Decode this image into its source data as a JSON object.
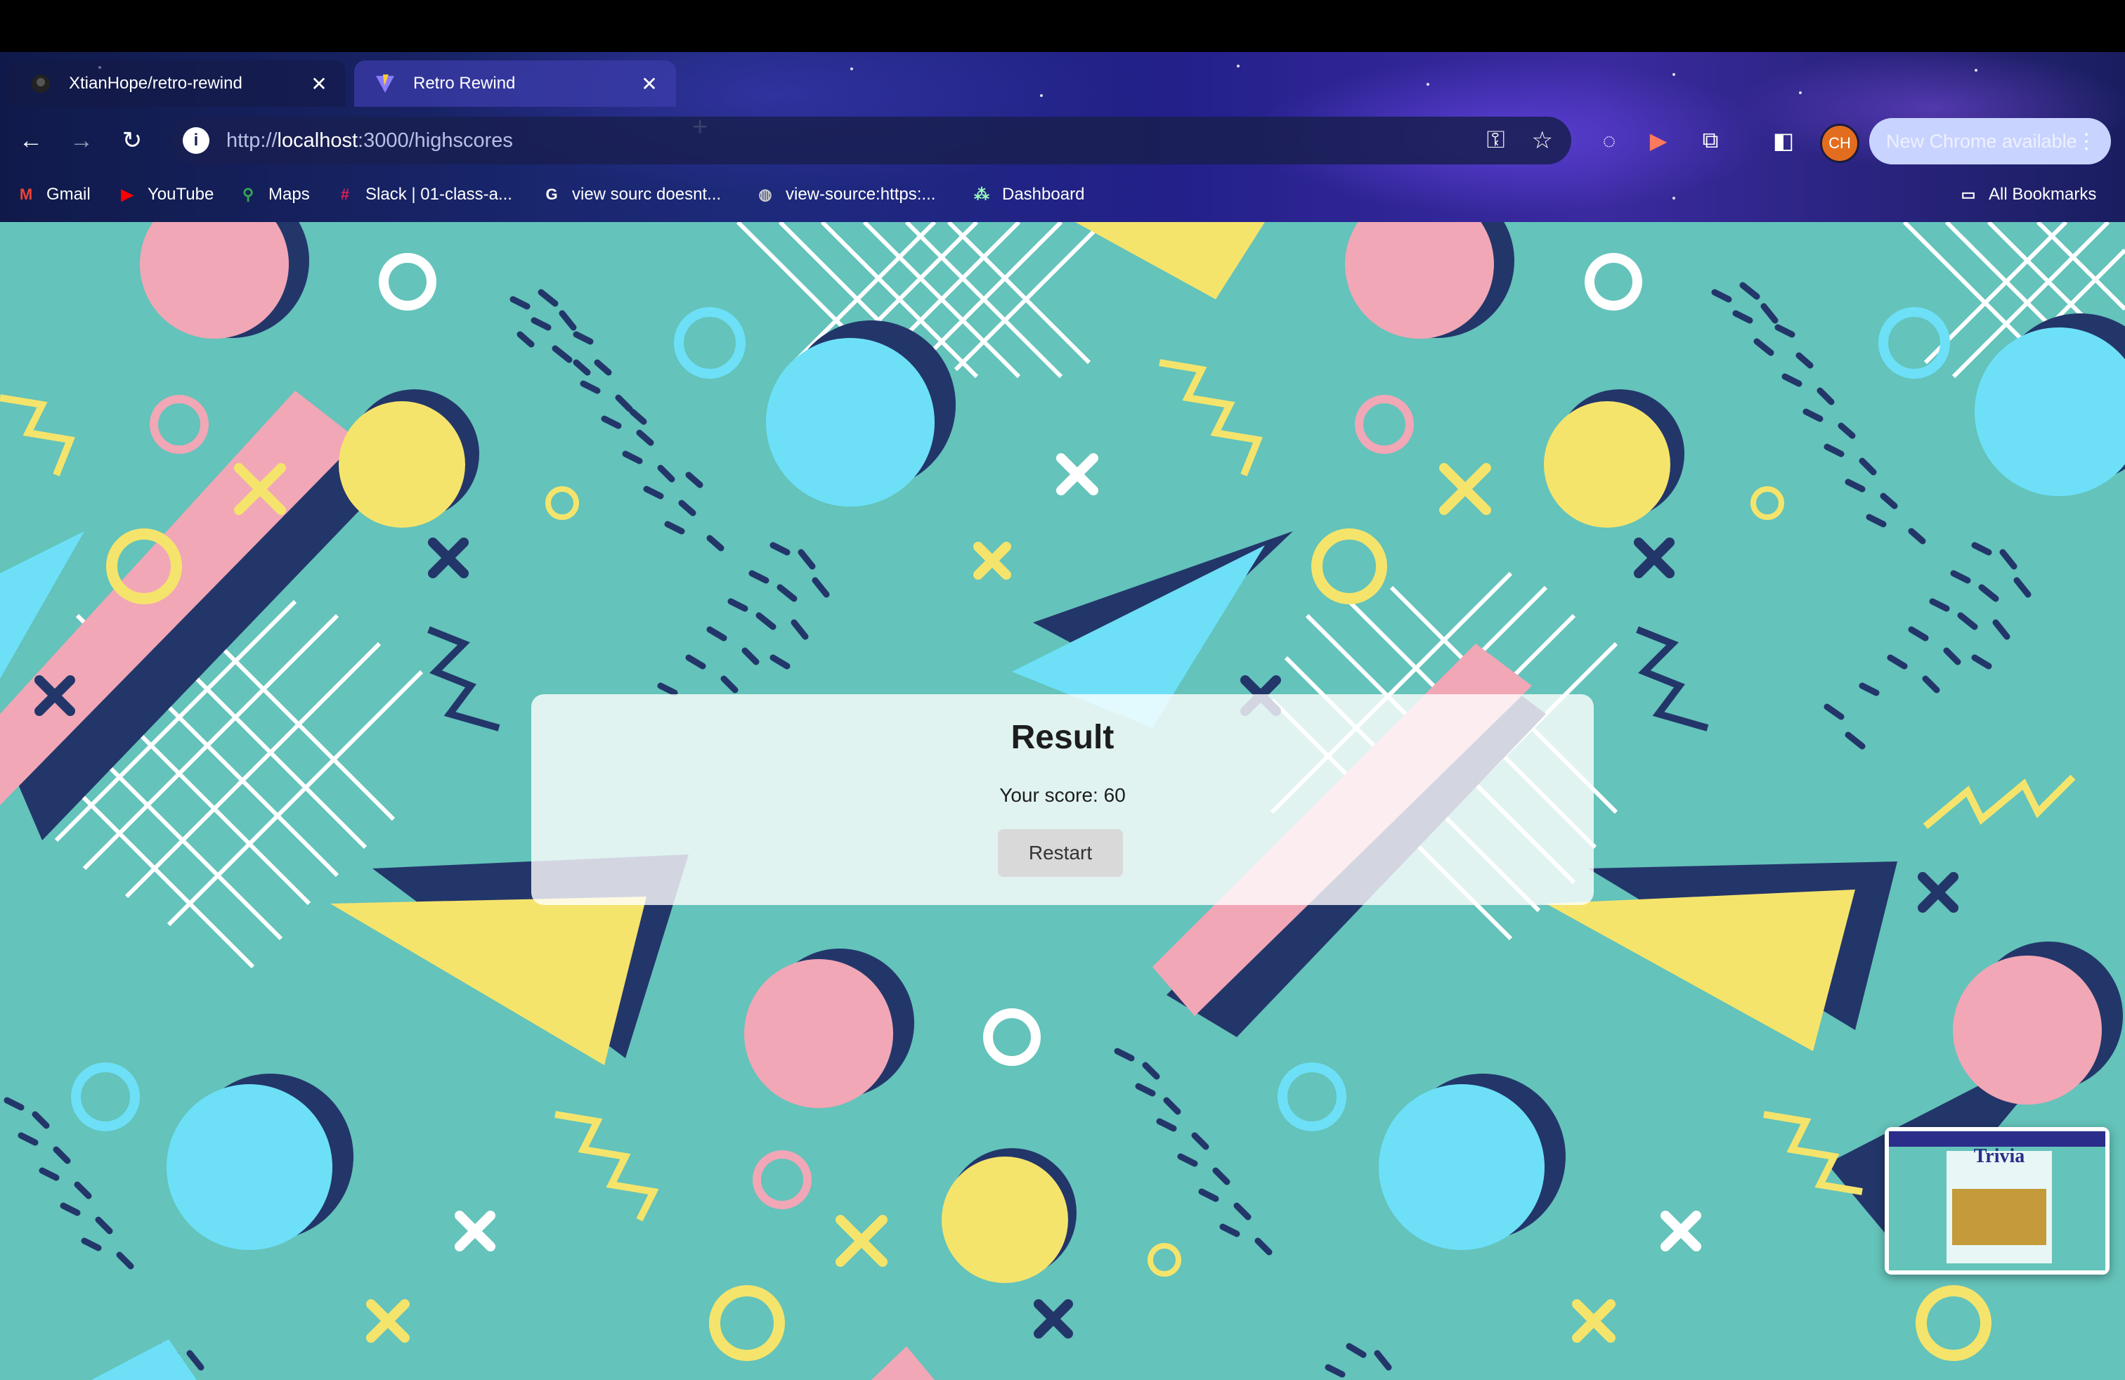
{
  "browser": {
    "tabs": [
      {
        "title": "XtianHope/retro-rewind",
        "active": false,
        "icon": "github-icon"
      },
      {
        "title": "Retro Rewind",
        "active": true,
        "icon": "vite-icon"
      }
    ],
    "url": {
      "scheme": "http://",
      "host": "localhost",
      "path": ":3000/highscores"
    },
    "avatar_initials": "CH",
    "update_label": "New Chrome available",
    "bookmarks": [
      {
        "label": "Gmail",
        "icon": "gmail-icon"
      },
      {
        "label": "YouTube",
        "icon": "youtube-icon"
      },
      {
        "label": "Maps",
        "icon": "maps-icon"
      },
      {
        "label": "Slack | 01-class-a...",
        "icon": "slack-icon"
      },
      {
        "label": "view sourc doesnt...",
        "icon": "google-icon"
      },
      {
        "label": "view-source:https:...",
        "icon": "globe-icon"
      },
      {
        "label": "Dashboard",
        "icon": "dashboard-icon"
      }
    ],
    "all_bookmarks_label": "All Bookmarks"
  },
  "result": {
    "title": "Result",
    "score_text": "Your score: 60",
    "restart_label": "Restart"
  },
  "pip_preview": {
    "heading": "Trivia"
  },
  "colors": {
    "page_background": "#64c3ba",
    "pink": "#f1a7b6",
    "yellow": "#f5e46c",
    "cyan": "#6de0f8",
    "navy": "#23366a",
    "white": "#ffffff"
  }
}
